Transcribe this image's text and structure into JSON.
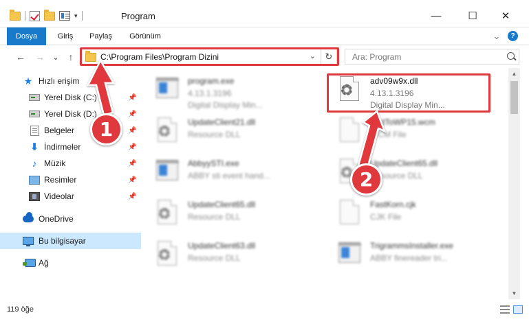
{
  "window": {
    "title": "Program",
    "minimize_glyph": "—",
    "maximize_glyph": "☐",
    "close_glyph": "✕"
  },
  "ribbon": {
    "tabs": [
      {
        "label": "Dosya"
      },
      {
        "label": "Giriş"
      },
      {
        "label": "Paylaş"
      },
      {
        "label": "Görünüm"
      }
    ],
    "expand_glyph": "⌄",
    "help_glyph": "?"
  },
  "nav": {
    "back_glyph": "←",
    "forward_glyph": "→",
    "recent_glyph": "⌄",
    "up_glyph": "↑",
    "address": "C:\\Program Files\\Program Dizini",
    "dropdown_glyph": "⌄",
    "refresh_glyph": "↻",
    "search_placeholder": "Ara: Program"
  },
  "sidebar": {
    "items": [
      {
        "label": "Hızlı erişim",
        "icon": "star-icon"
      },
      {
        "label": "Yerel Disk (C:)",
        "icon": "disk-icon",
        "pinned": true
      },
      {
        "label": "Yerel Disk (D:)",
        "icon": "disk-icon",
        "pinned": true
      },
      {
        "label": "Belgeler",
        "icon": "document-icon",
        "pinned": true
      },
      {
        "label": "İndirmeler",
        "icon": "download-icon",
        "pinned": true
      },
      {
        "label": "Müzik",
        "icon": "music-icon",
        "pinned": true
      },
      {
        "label": "Resimler",
        "icon": "pictures-icon",
        "pinned": true
      },
      {
        "label": "Videolar",
        "icon": "videos-icon",
        "pinned": true
      },
      {
        "label": "OneDrive",
        "icon": "cloud-icon"
      },
      {
        "label": "Bu bilgisayar",
        "icon": "computer-icon",
        "selected": true
      },
      {
        "label": "Ağ",
        "icon": "network-icon"
      }
    ],
    "pin_glyph": "📌",
    "star_glyph": "★",
    "download_glyph": "⬇",
    "music_glyph": "♪"
  },
  "files": [
    {
      "name": "program.exe",
      "line2": "4.13.1.3196",
      "line3": "Digital Display Min...",
      "type": "exe",
      "blurred": true
    },
    {
      "name": "adv09w9x.dll",
      "line2": "4.13.1.3196",
      "line3": "Digital Display Min...",
      "type": "dll",
      "blurred": false,
      "highlighted": true
    },
    {
      "name": "UpdateClient21.dll",
      "line2": "Resource DLL",
      "line3": "",
      "type": "dll",
      "blurred": true
    },
    {
      "name": "AddToWP15.wcm",
      "line2": "WCM File",
      "line3": "",
      "type": "page",
      "blurred": true
    },
    {
      "name": "AbbyySTI.exe",
      "line2": "ABBY sti event hand...",
      "line3": "",
      "type": "exe",
      "blurred": true
    },
    {
      "name": "UpdateClient65.dll",
      "line2": "Resource DLL",
      "line3": "",
      "type": "dll",
      "blurred": true
    },
    {
      "name": "UpdateClient65.dll",
      "line2": "Resource DLL",
      "line3": "",
      "type": "dll",
      "blurred": true
    },
    {
      "name": "FastKorn.cjk",
      "line2": "CJK File",
      "line3": "",
      "type": "page",
      "blurred": true
    },
    {
      "name": "UpdateClient63.dll",
      "line2": "Resource DLL",
      "line3": "",
      "type": "dll",
      "blurred": true
    },
    {
      "name": "TrigrammsInstaller.exe",
      "line2": "ABBY finereader tri...",
      "line3": "",
      "type": "exe",
      "blurred": true
    }
  ],
  "scrollbar": {
    "up_glyph": "▲",
    "down_glyph": "▼"
  },
  "status": {
    "item_count": "119 öğe"
  },
  "callouts": [
    {
      "number": "1"
    },
    {
      "number": "2"
    }
  ],
  "colors": {
    "accent": "#1979ca",
    "highlight_red": "#e0393d",
    "selected_bg": "#cce8ff"
  }
}
